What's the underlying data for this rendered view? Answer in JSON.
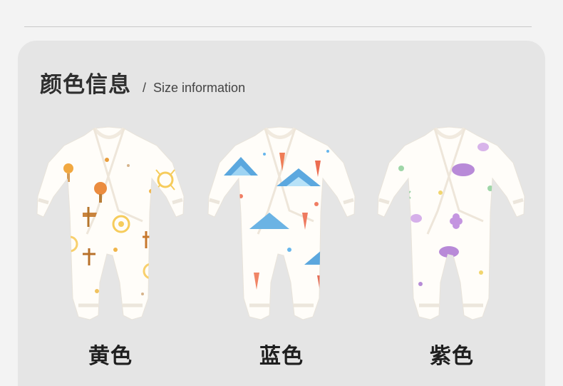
{
  "section": {
    "title_cn": "颜色信息",
    "separator": "/",
    "title_en": "Size information"
  },
  "products": [
    {
      "label": "黄色",
      "accent_colors": [
        "#f3b63f",
        "#e9853b",
        "#c37a2a"
      ],
      "pattern": "sun-tree-sign"
    },
    {
      "label": "蓝色",
      "accent_colors": [
        "#5aa7de",
        "#ef8a66",
        "#e36a5b"
      ],
      "pattern": "cloud-mountain-carrot"
    },
    {
      "label": "紫色",
      "accent_colors": [
        "#b68ad6",
        "#98d2a6",
        "#f2d46c"
      ],
      "pattern": "cloud-flower"
    }
  ],
  "colors": {
    "page_background": "#f3f3f3",
    "panel_background": "#e5e5e5",
    "divider": "#c9c9c9",
    "heading_text": "#2f2f2f",
    "label_text": "#1f1f1f",
    "garment_base": "#fffdf9"
  }
}
